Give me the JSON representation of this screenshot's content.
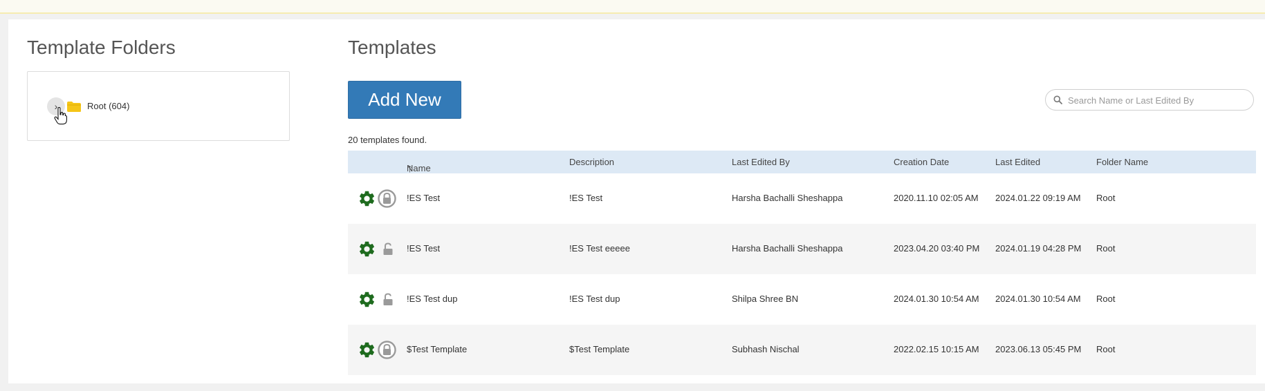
{
  "folders": {
    "title": "Template Folders",
    "root_label": "Root (604)"
  },
  "templates": {
    "title": "Templates",
    "add_button": "Add New",
    "search_placeholder": "Search Name or Last Edited By",
    "count_text": "20 templates found.",
    "sort_arrow": "🡑",
    "columns": {
      "name": "Name",
      "description": "Description",
      "last_edited_by": "Last Edited By",
      "creation_date": "Creation Date",
      "last_edited": "Last Edited",
      "folder_name": "Folder Name"
    },
    "rows": [
      {
        "name": "!ES Test",
        "description": "!ES Test",
        "last_edited_by": "Harsha Bachalli Sheshappa",
        "creation_date": "2020.11.10 02:05 AM",
        "last_edited": "2024.01.22 09:19 AM",
        "folder": "Root",
        "lock": "locked"
      },
      {
        "name": "!ES Test",
        "description": "!ES Test eeeee",
        "last_edited_by": "Harsha Bachalli Sheshappa",
        "creation_date": "2023.04.20 03:40 PM",
        "last_edited": "2024.01.19 04:28 PM",
        "folder": "Root",
        "lock": "unlocked"
      },
      {
        "name": "!ES Test dup",
        "description": "!ES Test dup",
        "last_edited_by": "Shilpa Shree BN",
        "creation_date": "2024.01.30 10:54 AM",
        "last_edited": "2024.01.30 10:54 AM",
        "folder": "Root",
        "lock": "unlocked"
      },
      {
        "name": "$Test Template",
        "description": "$Test Template",
        "last_edited_by": "Subhash Nischal",
        "creation_date": "2022.02.15 10:15 AM",
        "last_edited": "2023.06.13 05:45 PM",
        "folder": "Root",
        "lock": "locked"
      }
    ]
  },
  "colors": {
    "accent": "#337ab7",
    "header_bg": "#dde9f5",
    "gear": "#1e6b1e",
    "folder": "#f5c518"
  },
  "icons": {
    "expand": "chevron-right-icon",
    "folder": "folder-icon",
    "search": "search-icon",
    "settings": "gear-icon",
    "lock_locked": "lock-circle-icon",
    "lock_unlocked": "unlock-icon"
  }
}
